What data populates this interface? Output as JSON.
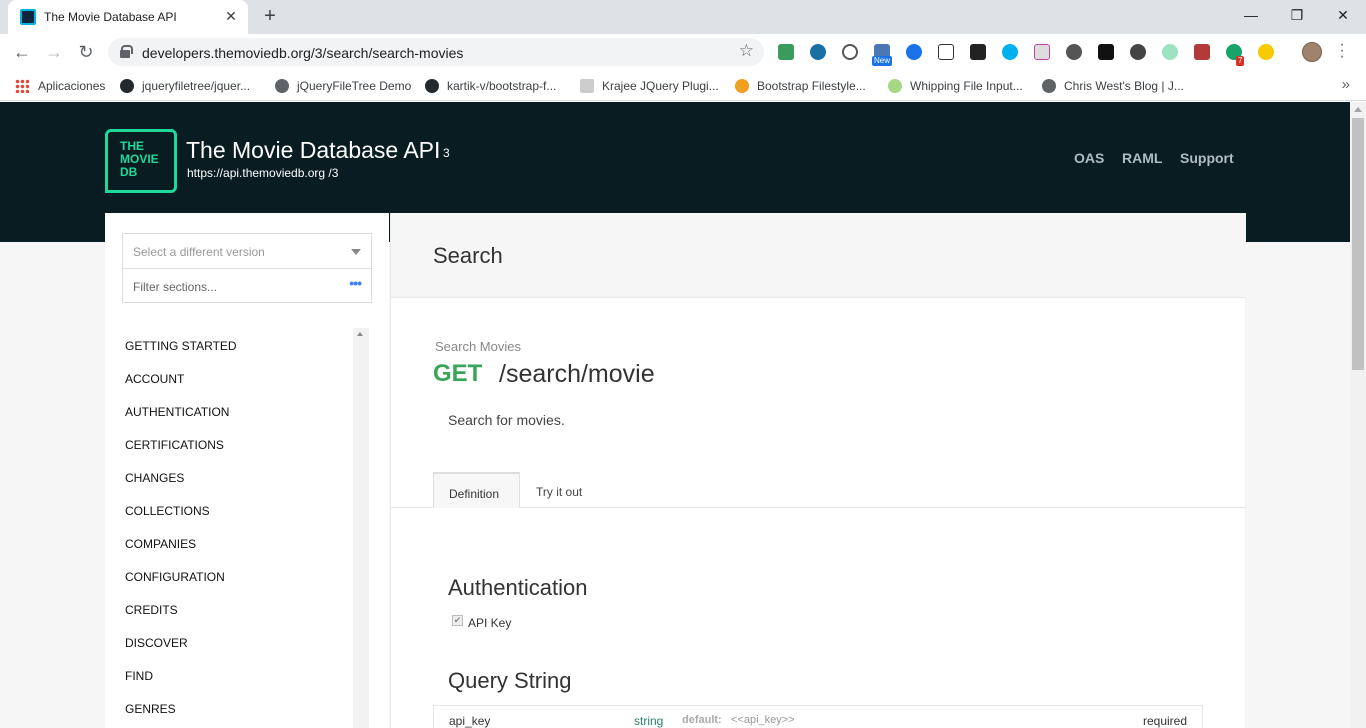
{
  "browser": {
    "tab_title": "The Movie Database API",
    "tab_close": "✕",
    "new_tab": "+",
    "window_controls": {
      "minimize": "—",
      "maximize": "❐",
      "close": "✕"
    },
    "nav": {
      "back": "←",
      "forward": "→",
      "reload": "↻"
    },
    "url": "developers.themoviedb.org/3/search/search-movies",
    "star": "☆",
    "extension_badges": {
      "new": "New",
      "count": "7"
    },
    "bookmarks": [
      {
        "label": "Aplicaciones",
        "icon": "apps-grid-icon"
      },
      {
        "label": "jqueryfiletree/jquer...",
        "icon": "github-icon"
      },
      {
        "label": "jQueryFileTree Demo",
        "icon": "globe-icon"
      },
      {
        "label": "kartik-v/bootstrap-f...",
        "icon": "github-icon"
      },
      {
        "label": "Krajee JQuery Plugi...",
        "icon": "krajee-icon"
      },
      {
        "label": "Bootstrap Filestyle...",
        "icon": "filestyle-icon"
      },
      {
        "label": "Whipping File Input...",
        "icon": "leaf-icon"
      },
      {
        "label": "Chris West's Blog | J...",
        "icon": "globe-icon"
      }
    ],
    "bookmarks_more": "»"
  },
  "header": {
    "logo_text": "THE MOVIE DB",
    "title": "The Movie Database API",
    "version": "3",
    "base_url": "https://api.themoviedb.org /3",
    "links": [
      "OAS",
      "RAML",
      "Support"
    ]
  },
  "sidebar": {
    "version_placeholder": "Select a different version",
    "filter_placeholder": "Filter sections...",
    "filter_dots": "•••",
    "items": [
      "GETTING STARTED",
      "ACCOUNT",
      "AUTHENTICATION",
      "CERTIFICATIONS",
      "CHANGES",
      "COLLECTIONS",
      "COMPANIES",
      "CONFIGURATION",
      "CREDITS",
      "DISCOVER",
      "FIND",
      "GENRES"
    ]
  },
  "content": {
    "section_title": "Search",
    "endpoint_name": "Search Movies",
    "method": "GET",
    "path": "/search/movie",
    "description": "Search for movies.",
    "tabs": [
      "Definition",
      "Try it out"
    ],
    "auth_title": "Authentication",
    "auth_checkbox": "✔",
    "auth_item": "API Key",
    "query_title": "Query String",
    "params": [
      {
        "name": "api_key",
        "type": "string",
        "default_label": "default:",
        "default": "<<api_key>>",
        "required": "required"
      }
    ]
  },
  "colors": {
    "hero_bg": "#081c22",
    "brand_green": "#1ed99a",
    "get_green": "#3aa55a"
  }
}
